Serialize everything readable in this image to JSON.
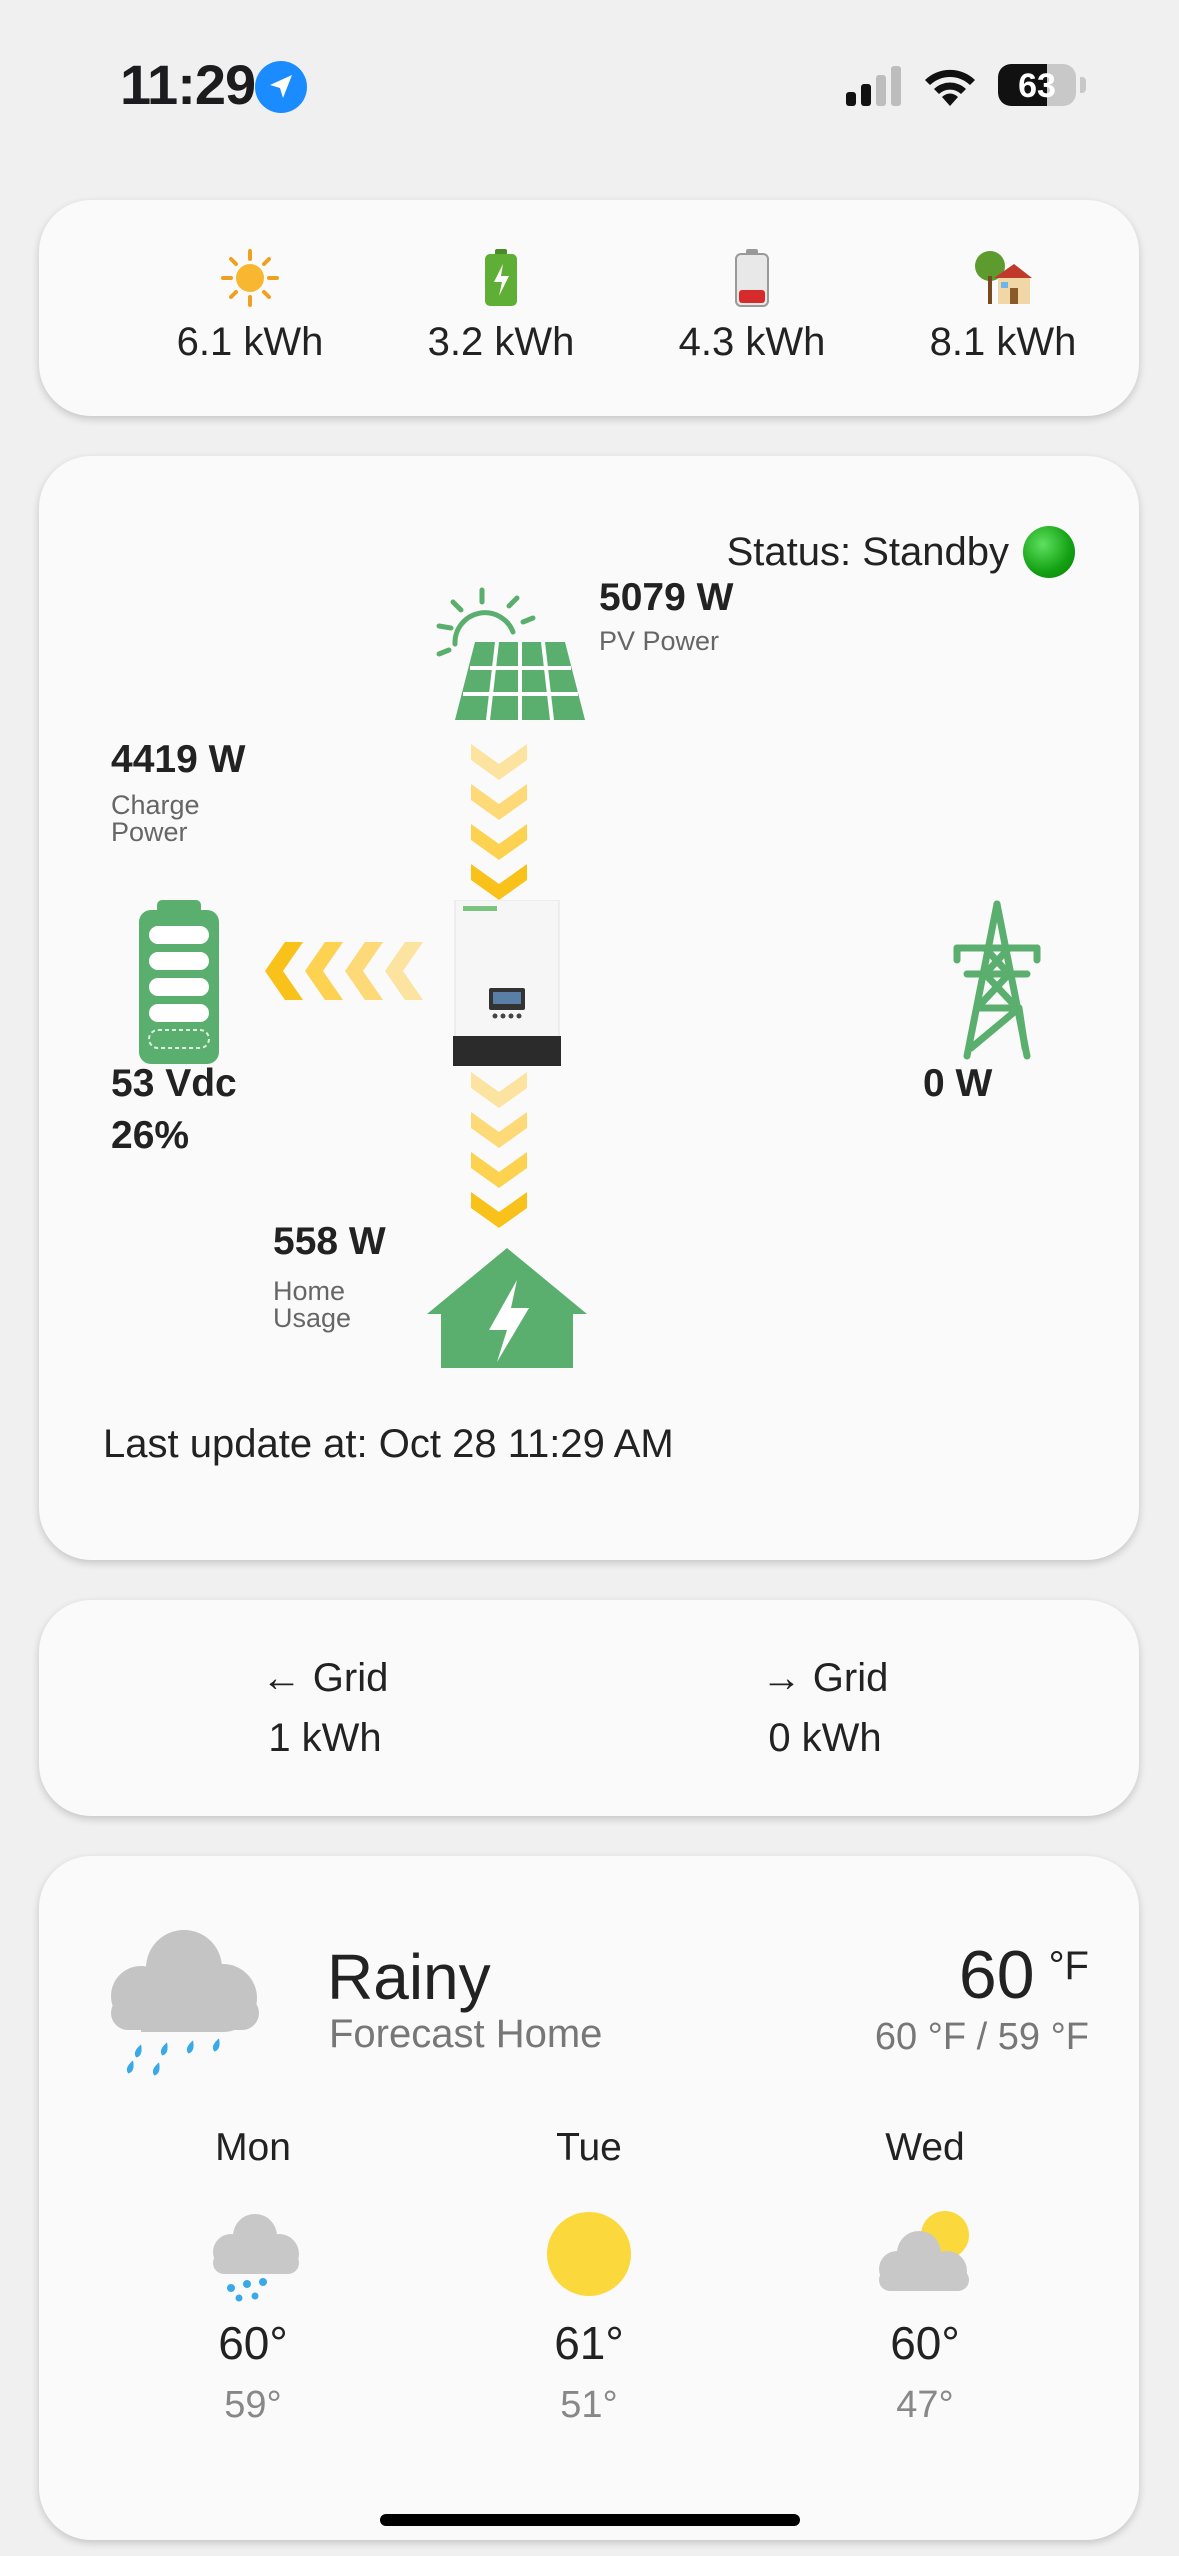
{
  "status_bar": {
    "time": "11:29",
    "battery_level": "63",
    "battery_fraction": 0.63,
    "signal_bars": 2,
    "icons": [
      "location-arrow-icon",
      "cellular-signal-icon",
      "wifi-icon",
      "battery-icon"
    ]
  },
  "summary": {
    "items": [
      {
        "icon": "sun-icon",
        "value": "6.1 kWh"
      },
      {
        "icon": "battery-charging-icon",
        "value": "3.2 kWh"
      },
      {
        "icon": "battery-low-icon",
        "value": "4.3 kWh"
      },
      {
        "icon": "house-with-tree-icon",
        "value": "8.1 kWh"
      }
    ]
  },
  "flow": {
    "status_text": "Status: Standby",
    "status_color": "#1aa81a",
    "pv": {
      "value": "5079 W",
      "label": "PV Power"
    },
    "charge": {
      "value": "4419 W",
      "label_line1": "Charge",
      "label_line2": "Power"
    },
    "battery": {
      "voltage": "53 Vdc",
      "soc": "26%"
    },
    "grid": {
      "value": "0 W"
    },
    "home": {
      "value": "558 W",
      "label_line1": "Home",
      "label_line2": "Usage"
    },
    "last_update": "Last update at: Oct 28 11:29 AM",
    "accent": "#5aaf6e",
    "arrow_color": "#f9c21a"
  },
  "grid_energy": {
    "import": {
      "label": "← Grid",
      "value": "1 kWh"
    },
    "export": {
      "label": "→ Grid",
      "value": "0 kWh"
    }
  },
  "weather": {
    "condition": "Rainy",
    "location": "Forecast Home",
    "temp": "60",
    "unit": "°F",
    "range": "60 °F / 59 °F",
    "days": [
      {
        "name": "Mon",
        "icon": "rain-cloud-icon",
        "hi": "60°",
        "lo": "59°"
      },
      {
        "name": "Tue",
        "icon": "sun-icon",
        "hi": "61°",
        "lo": "51°"
      },
      {
        "name": "Wed",
        "icon": "partly-cloudy-icon",
        "hi": "60°",
        "lo": "47°"
      }
    ]
  }
}
